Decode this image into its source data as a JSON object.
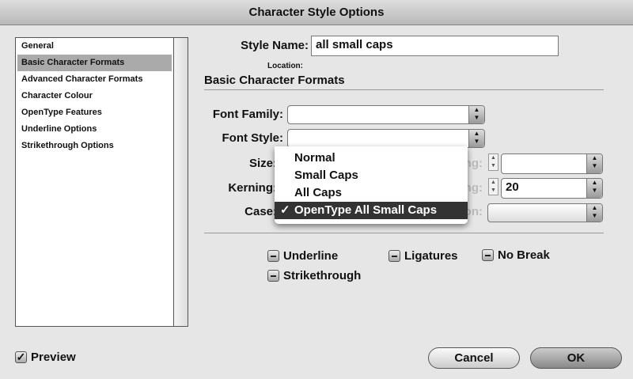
{
  "window": {
    "title": "Character Style Options"
  },
  "sidebar": {
    "items": [
      {
        "label": "General",
        "selected": false
      },
      {
        "label": "Basic Character Formats",
        "selected": true
      },
      {
        "label": "Advanced Character Formats",
        "selected": false
      },
      {
        "label": "Character Colour",
        "selected": false
      },
      {
        "label": "OpenType Features",
        "selected": false
      },
      {
        "label": "Underline Options",
        "selected": false
      },
      {
        "label": "Strikethrough Options",
        "selected": false
      }
    ]
  },
  "style_name": {
    "label": "Style Name:",
    "value": "all small caps"
  },
  "location_label": "Location:",
  "section_title": "Basic Character Formats",
  "fields": {
    "font_family": {
      "label": "Font Family:",
      "value": ""
    },
    "font_style": {
      "label": "Font Style:",
      "value": ""
    },
    "size": {
      "label": "Size:"
    },
    "leading": {
      "label": "Leading:",
      "value": ""
    },
    "kerning": {
      "label": "Kerning:"
    },
    "tracking": {
      "label": "Tracking:",
      "value": "20"
    },
    "case": {
      "label": "Case:"
    },
    "position": {
      "label": "Position:",
      "value": ""
    }
  },
  "case_menu": {
    "options": [
      "Normal",
      "Small Caps",
      "All Caps",
      "OpenType All Small Caps"
    ],
    "selected": "OpenType All Small Caps",
    "check": "✓"
  },
  "checkboxes": [
    {
      "label": "Underline",
      "state": "mixed"
    },
    {
      "label": "Ligatures",
      "state": "mixed"
    },
    {
      "label": "No Break",
      "state": "mixed"
    },
    {
      "label": "Strikethrough",
      "state": "mixed"
    }
  ],
  "preview": {
    "label": "Preview",
    "checked": true,
    "check": "✓"
  },
  "buttons": {
    "cancel": "Cancel",
    "ok": "OK"
  }
}
